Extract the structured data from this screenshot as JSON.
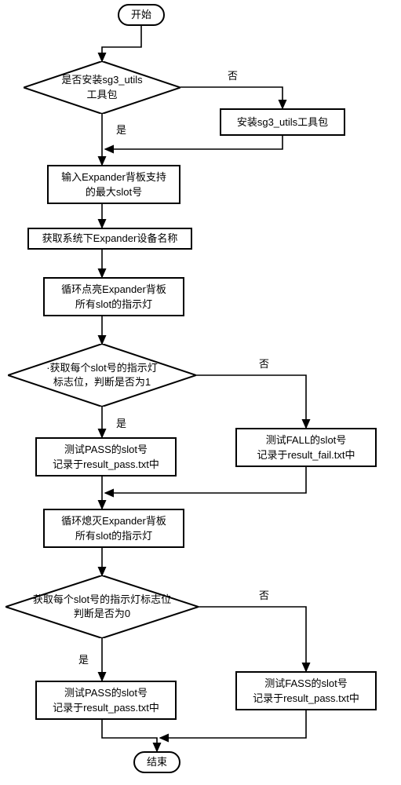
{
  "chart_data": {
    "type": "flowchart",
    "title": "",
    "nodes": [
      {
        "id": "start",
        "type": "terminator",
        "label": "开始"
      },
      {
        "id": "d1",
        "type": "decision",
        "label": "是否安装sg3_utils工具包"
      },
      {
        "id": "p_install",
        "type": "process",
        "label": "安装sg3_utils工具包"
      },
      {
        "id": "p_input",
        "type": "process",
        "label": "输入Expander背板支持的最大slot号"
      },
      {
        "id": "p_getname",
        "type": "process",
        "label": "获取系统下Expander设备名称"
      },
      {
        "id": "p_lighton",
        "type": "process",
        "label": "循环点亮Expander背板所有slot的指示灯"
      },
      {
        "id": "d2",
        "type": "decision",
        "label": "·获取每个slot号的指示灯标志位，判断是否为1"
      },
      {
        "id": "p_pass1",
        "type": "process",
        "label": "测试PASS的slot号记录于result_pass.txt中"
      },
      {
        "id": "p_fail1",
        "type": "process",
        "label": "测试FALL的slot号记录于result_fail.txt中"
      },
      {
        "id": "p_lightoff",
        "type": "process",
        "label": "循环熄灭Expander背板所有slot的指示灯"
      },
      {
        "id": "d3",
        "type": "decision",
        "label": "获取每个slot号的指示灯标志位判断是否为0"
      },
      {
        "id": "p_pass2",
        "type": "process",
        "label": "测试PASS的slot号记录于result_pass.txt中"
      },
      {
        "id": "p_fass",
        "type": "process",
        "label": "测试FASS的slot号记录于result_pass.txt中"
      },
      {
        "id": "end",
        "type": "terminator",
        "label": "结束"
      }
    ],
    "edges": [
      {
        "from": "start",
        "to": "d1"
      },
      {
        "from": "d1",
        "to": "p_install",
        "label": "否"
      },
      {
        "from": "d1",
        "to": "p_input",
        "label": "是"
      },
      {
        "from": "p_install",
        "to": "p_input"
      },
      {
        "from": "p_input",
        "to": "p_getname"
      },
      {
        "from": "p_getname",
        "to": "p_lighton"
      },
      {
        "from": "p_lighton",
        "to": "d2"
      },
      {
        "from": "d2",
        "to": "p_pass1",
        "label": "是"
      },
      {
        "from": "d2",
        "to": "p_fail1",
        "label": "否"
      },
      {
        "from": "p_pass1",
        "to": "p_lightoff"
      },
      {
        "from": "p_fail1",
        "to": "p_lightoff"
      },
      {
        "from": "p_lightoff",
        "to": "d3"
      },
      {
        "from": "d3",
        "to": "p_pass2",
        "label": "是"
      },
      {
        "from": "d3",
        "to": "p_fass",
        "label": "否"
      },
      {
        "from": "p_pass2",
        "to": "end"
      },
      {
        "from": "p_fass",
        "to": "end"
      }
    ]
  },
  "labels": {
    "start": "开始",
    "d1_l1": "是否安装sg3_utils",
    "d1_l2": "工具包",
    "p_install": "安装sg3_utils工具包",
    "p_input_l1": "输入Expander背板支持",
    "p_input_l2": "的最大slot号",
    "p_getname": "获取系统下Expander设备名称",
    "p_lighton_l1": "循环点亮Expander背板",
    "p_lighton_l2": "所有slot的指示灯",
    "d2_l1": "·获取每个slot号的指示灯",
    "d2_l2": "标志位，判断是否为1",
    "p_pass1_l1": "测试PASS的slot号",
    "p_pass1_l2": "记录于result_pass.txt中",
    "p_fail1_l1": "测试FALL的slot号",
    "p_fail1_l2": "记录于result_fail.txt中",
    "p_lightoff_l1": "循环熄灭Expander背板",
    "p_lightoff_l2": "所有slot的指示灯",
    "d3_l1": "获取每个slot号的指示灯标志位",
    "d3_l2": "判断是否为0",
    "p_pass2_l1": "测试PASS的slot号",
    "p_pass2_l2": "记录于result_pass.txt中",
    "p_fass_l1": "测试FASS的slot号",
    "p_fass_l2": "记录于result_pass.txt中",
    "end": "结束",
    "yes": "是",
    "no": "否"
  }
}
